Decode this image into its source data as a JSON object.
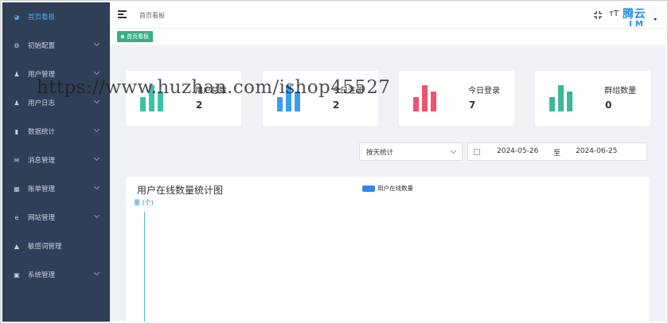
{
  "sidebar": {
    "items": [
      {
        "label": "首页看板",
        "icon": "dashboard-icon",
        "active": true,
        "has_children": false
      },
      {
        "label": "初始配置",
        "icon": "config-icon",
        "active": false,
        "has_children": true
      },
      {
        "label": "用户管理",
        "icon": "user-icon",
        "active": false,
        "has_children": true
      },
      {
        "label": "用户日志",
        "icon": "user-log-icon",
        "active": false,
        "has_children": true
      },
      {
        "label": "数据统计",
        "icon": "bar-chart-icon",
        "active": false,
        "has_children": true
      },
      {
        "label": "消息管理",
        "icon": "mail-icon",
        "active": false,
        "has_children": true
      },
      {
        "label": "账单管理",
        "icon": "bill-icon",
        "active": false,
        "has_children": true
      },
      {
        "label": "网站管理",
        "icon": "ie-icon",
        "active": false,
        "has_children": true
      },
      {
        "label": "敏感词管理",
        "icon": "warning-icon",
        "active": false,
        "has_children": false
      },
      {
        "label": "系统管理",
        "icon": "system-icon",
        "active": false,
        "has_children": true
      }
    ],
    "bg_color": "#2f3f57",
    "active_color": "#4aa6f8"
  },
  "header": {
    "breadcrumb": "首页看板",
    "brand_top": "腾云",
    "brand_bottom": "IM",
    "fontsize_label": "тT"
  },
  "tags": [
    {
      "label": "首页看板",
      "active": true
    }
  ],
  "stats": [
    {
      "label": "用户总数",
      "value": "2",
      "color": "#3cc0a8"
    },
    {
      "label": "今日注册",
      "value": "2",
      "color": "#3a9ef0"
    },
    {
      "label": "今日登录",
      "value": "7",
      "color": "#ec5570"
    },
    {
      "label": "群组数量",
      "value": "0",
      "color": "#3ab89a"
    }
  ],
  "filters": {
    "period": "按天统计",
    "start_date": "2024-05-26",
    "separator": "至",
    "end_date": "2024-06-25"
  },
  "chart_data": {
    "type": "bar",
    "title": "用户在线数量统计图",
    "ylabel": "量 (个)",
    "series": [
      {
        "name": "用户在线数量",
        "values": [],
        "color": "#3a84e8"
      }
    ],
    "categories": []
  },
  "watermark": "https://www.huzhan.com/ishop45527"
}
